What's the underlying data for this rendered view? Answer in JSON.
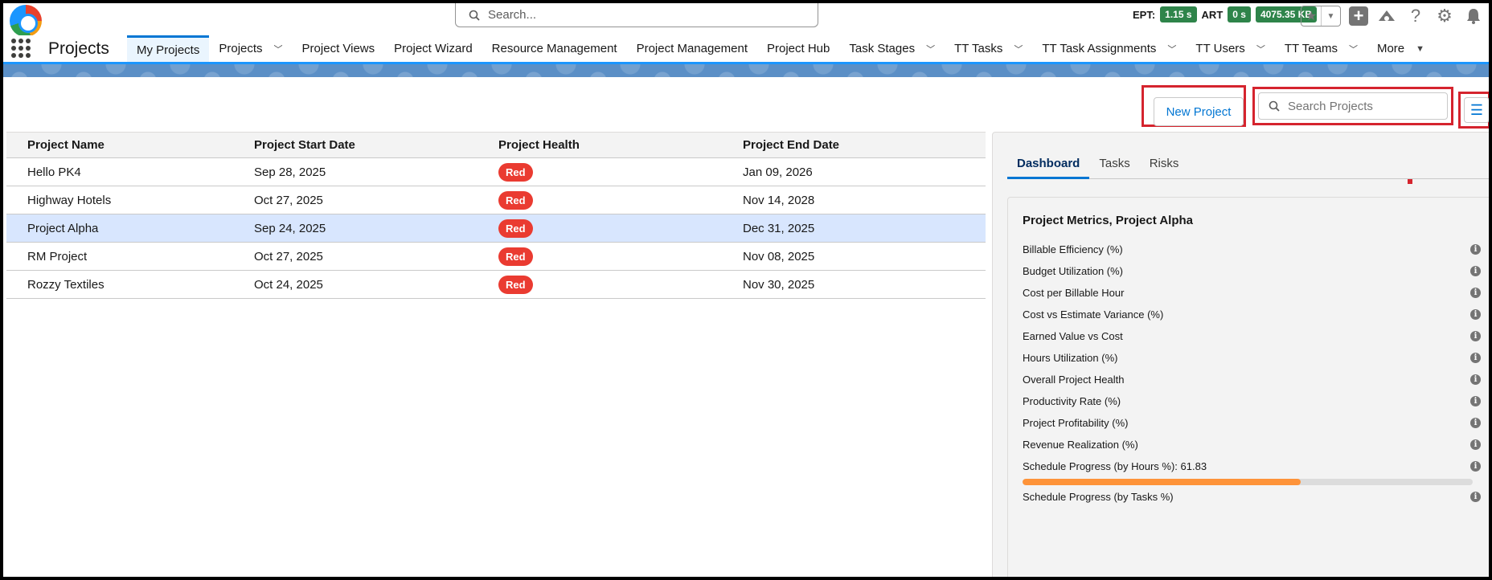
{
  "header": {
    "search_placeholder": "Search...",
    "perf": [
      {
        "label": "EPT:",
        "value": "1.15 s"
      },
      {
        "label": "ART",
        "value": "0 s"
      },
      {
        "label": "",
        "value": "4075.35 KB"
      }
    ],
    "icons": [
      "star-icon",
      "add-icon",
      "trailhead-icon",
      "help-icon",
      "setup-gear-icon",
      "notifications-bell-icon"
    ]
  },
  "nav": {
    "app_name": "Projects",
    "items": [
      {
        "label": "My Projects",
        "active": true,
        "dropdown": false
      },
      {
        "label": "Projects",
        "dropdown": true
      },
      {
        "label": "Project Views",
        "dropdown": false
      },
      {
        "label": "Project Wizard",
        "dropdown": false
      },
      {
        "label": "Resource Management",
        "dropdown": false
      },
      {
        "label": "Project Management",
        "dropdown": false
      },
      {
        "label": "Project Hub",
        "dropdown": false
      },
      {
        "label": "Task Stages",
        "dropdown": true
      },
      {
        "label": "TT Tasks",
        "dropdown": true
      },
      {
        "label": "TT Task Assignments",
        "dropdown": true
      },
      {
        "label": "TT Users",
        "dropdown": true
      },
      {
        "label": "TT Teams",
        "dropdown": true
      },
      {
        "label": "More",
        "dropdown": true
      }
    ]
  },
  "actions": {
    "new_project": "New Project",
    "search_placeholder": "Search Projects"
  },
  "table": {
    "columns": [
      "Project Name",
      "Project Start Date",
      "Project Health",
      "Project End Date"
    ],
    "rows": [
      {
        "name": "Hello PK4",
        "start": "Sep 28, 2025",
        "health": "Red",
        "end": "Jan 09, 2026"
      },
      {
        "name": "Highway Hotels",
        "start": "Oct 27, 2025",
        "health": "Red",
        "end": "Nov 14, 2028"
      },
      {
        "name": "Project Alpha",
        "start": "Sep 24, 2025",
        "health": "Red",
        "end": "Dec 31, 2025",
        "selected": true
      },
      {
        "name": "RM Project",
        "start": "Oct 27, 2025",
        "health": "Red",
        "end": "Nov 08, 2025"
      },
      {
        "name": "Rozzy Textiles",
        "start": "Oct 24, 2025",
        "health": "Red",
        "end": "Nov 30, 2025"
      }
    ]
  },
  "panel": {
    "tabs": [
      {
        "label": "Dashboard",
        "active": true
      },
      {
        "label": "Tasks"
      },
      {
        "label": "Risks"
      }
    ],
    "title": "Project Metrics, Project Alpha",
    "metrics": [
      "Billable Efficiency (%)",
      "Budget Utilization (%)",
      "Cost per Billable Hour",
      "Cost vs Estimate Variance (%)",
      "Earned Value vs Cost",
      "Hours Utilization (%)",
      "Overall Project Health",
      "Productivity Rate (%)",
      "Project Profitability (%)",
      "Revenue Realization (%)",
      "Schedule Progress (by Hours %): 61.83",
      "Schedule Progress (by Tasks %)"
    ],
    "schedule_progress_hours_pct": 61.83,
    "progress_color": "#fe9339"
  }
}
